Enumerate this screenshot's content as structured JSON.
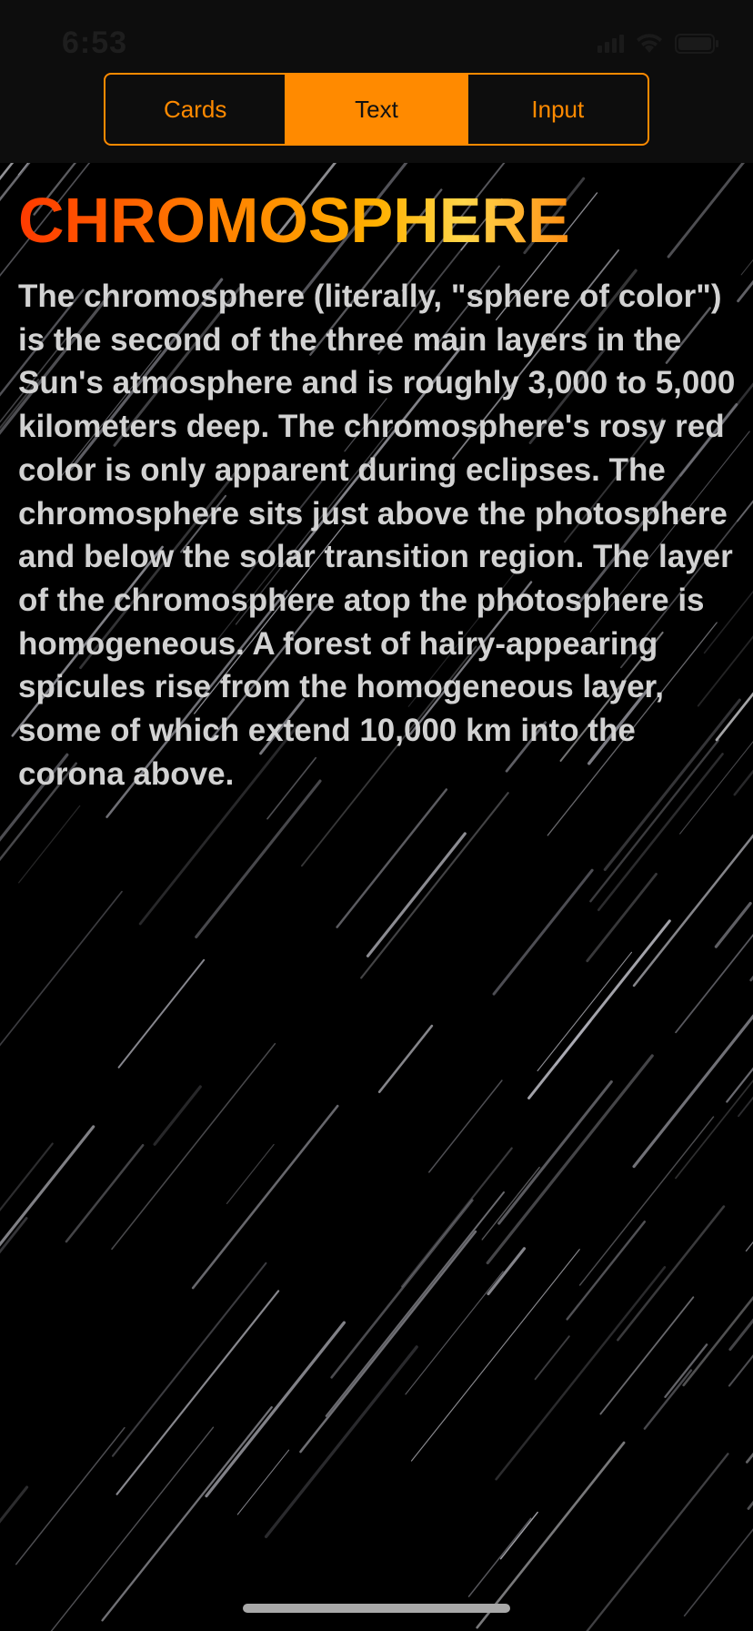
{
  "status_bar": {
    "time": "6:53"
  },
  "segmented_control": {
    "segments": [
      {
        "label": "Cards",
        "selected": false
      },
      {
        "label": "Text",
        "selected": true
      },
      {
        "label": "Input",
        "selected": false
      }
    ]
  },
  "article": {
    "title": "CHROMOSPHERE",
    "body": "The chromosphere (literally, \"sphere of color\") is the second of the three main layers in the Sun's atmosphere and is roughly 3,000 to 5,000 kilometers deep. The chromosphere's rosy red color is only apparent during eclipses. The chromosphere sits just above the photosphere and below the solar transition region. The layer of the chromosphere atop the photosphere is homogeneous. A forest of hairy-appearing spicules rise from the homogeneous layer, some of which extend 10,000 km into the corona above."
  },
  "colors": {
    "accent": "#ff8a00",
    "header_background": "#0d0d0d",
    "background": "#000000",
    "body_text": "#d2d2d2"
  },
  "icons": [
    "cellular-signal-icon",
    "wifi-icon",
    "battery-icon"
  ]
}
